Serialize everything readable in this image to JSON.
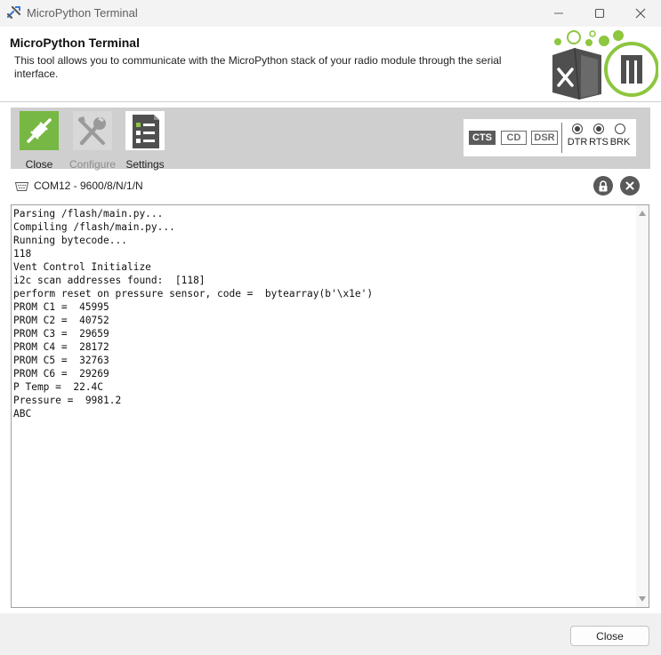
{
  "window": {
    "title": "MicroPython Terminal",
    "minimize_icon": "minimize-icon",
    "maximize_icon": "maximize-icon",
    "close_icon": "close-icon"
  },
  "header": {
    "title": "MicroPython Terminal",
    "description": "This tool allows you to communicate with the MicroPython stack of your radio module through the serial interface."
  },
  "toolbar": {
    "close_label": "Close",
    "configure_label": "Configure",
    "settings_label": "Settings",
    "accent_color": "#76b843"
  },
  "signals": {
    "cts": "CTS",
    "cd": "CD",
    "dsr": "DSR",
    "dtr": "DTR",
    "rts": "RTS",
    "brk": "BRK",
    "dtr_on": true,
    "rts_on": true,
    "brk_on": false
  },
  "port": {
    "label": "COM12 - 9600/8/N/1/N"
  },
  "console": {
    "lines": [
      "Parsing /flash/main.py...",
      "Compiling /flash/main.py...",
      "Running bytecode...",
      "118",
      "Vent Control Initialize",
      "i2c scan addresses found:  [118]",
      "perform reset on pressure sensor, code =  bytearray(b'\\x1e')",
      "PROM C1 =  45995",
      "PROM C2 =  40752",
      "PROM C3 =  29659",
      "PROM C4 =  28172",
      "PROM C5 =  32763",
      "PROM C6 =  29269",
      "P Temp =  22.4C",
      "Pressure =  9981.2",
      "ABC"
    ]
  },
  "footer": {
    "close_label": "Close"
  }
}
